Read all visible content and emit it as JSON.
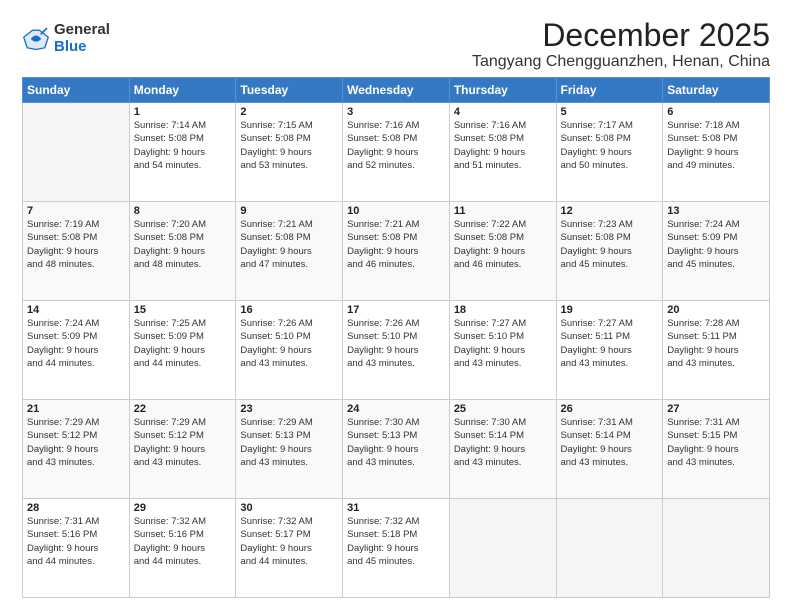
{
  "logo": {
    "general": "General",
    "blue": "Blue"
  },
  "title": {
    "month": "December 2025",
    "location": "Tangyang Chengguanzhen, Henan, China"
  },
  "days_of_week": [
    "Sunday",
    "Monday",
    "Tuesday",
    "Wednesday",
    "Thursday",
    "Friday",
    "Saturday"
  ],
  "weeks": [
    [
      {
        "day": "",
        "info": ""
      },
      {
        "day": "1",
        "info": "Sunrise: 7:14 AM\nSunset: 5:08 PM\nDaylight: 9 hours\nand 54 minutes."
      },
      {
        "day": "2",
        "info": "Sunrise: 7:15 AM\nSunset: 5:08 PM\nDaylight: 9 hours\nand 53 minutes."
      },
      {
        "day": "3",
        "info": "Sunrise: 7:16 AM\nSunset: 5:08 PM\nDaylight: 9 hours\nand 52 minutes."
      },
      {
        "day": "4",
        "info": "Sunrise: 7:16 AM\nSunset: 5:08 PM\nDaylight: 9 hours\nand 51 minutes."
      },
      {
        "day": "5",
        "info": "Sunrise: 7:17 AM\nSunset: 5:08 PM\nDaylight: 9 hours\nand 50 minutes."
      },
      {
        "day": "6",
        "info": "Sunrise: 7:18 AM\nSunset: 5:08 PM\nDaylight: 9 hours\nand 49 minutes."
      }
    ],
    [
      {
        "day": "7",
        "info": "Sunrise: 7:19 AM\nSunset: 5:08 PM\nDaylight: 9 hours\nand 48 minutes."
      },
      {
        "day": "8",
        "info": "Sunrise: 7:20 AM\nSunset: 5:08 PM\nDaylight: 9 hours\nand 48 minutes."
      },
      {
        "day": "9",
        "info": "Sunrise: 7:21 AM\nSunset: 5:08 PM\nDaylight: 9 hours\nand 47 minutes."
      },
      {
        "day": "10",
        "info": "Sunrise: 7:21 AM\nSunset: 5:08 PM\nDaylight: 9 hours\nand 46 minutes."
      },
      {
        "day": "11",
        "info": "Sunrise: 7:22 AM\nSunset: 5:08 PM\nDaylight: 9 hours\nand 46 minutes."
      },
      {
        "day": "12",
        "info": "Sunrise: 7:23 AM\nSunset: 5:08 PM\nDaylight: 9 hours\nand 45 minutes."
      },
      {
        "day": "13",
        "info": "Sunrise: 7:24 AM\nSunset: 5:09 PM\nDaylight: 9 hours\nand 45 minutes."
      }
    ],
    [
      {
        "day": "14",
        "info": "Sunrise: 7:24 AM\nSunset: 5:09 PM\nDaylight: 9 hours\nand 44 minutes."
      },
      {
        "day": "15",
        "info": "Sunrise: 7:25 AM\nSunset: 5:09 PM\nDaylight: 9 hours\nand 44 minutes."
      },
      {
        "day": "16",
        "info": "Sunrise: 7:26 AM\nSunset: 5:10 PM\nDaylight: 9 hours\nand 43 minutes."
      },
      {
        "day": "17",
        "info": "Sunrise: 7:26 AM\nSunset: 5:10 PM\nDaylight: 9 hours\nand 43 minutes."
      },
      {
        "day": "18",
        "info": "Sunrise: 7:27 AM\nSunset: 5:10 PM\nDaylight: 9 hours\nand 43 minutes."
      },
      {
        "day": "19",
        "info": "Sunrise: 7:27 AM\nSunset: 5:11 PM\nDaylight: 9 hours\nand 43 minutes."
      },
      {
        "day": "20",
        "info": "Sunrise: 7:28 AM\nSunset: 5:11 PM\nDaylight: 9 hours\nand 43 minutes."
      }
    ],
    [
      {
        "day": "21",
        "info": "Sunrise: 7:29 AM\nSunset: 5:12 PM\nDaylight: 9 hours\nand 43 minutes."
      },
      {
        "day": "22",
        "info": "Sunrise: 7:29 AM\nSunset: 5:12 PM\nDaylight: 9 hours\nand 43 minutes."
      },
      {
        "day": "23",
        "info": "Sunrise: 7:29 AM\nSunset: 5:13 PM\nDaylight: 9 hours\nand 43 minutes."
      },
      {
        "day": "24",
        "info": "Sunrise: 7:30 AM\nSunset: 5:13 PM\nDaylight: 9 hours\nand 43 minutes."
      },
      {
        "day": "25",
        "info": "Sunrise: 7:30 AM\nSunset: 5:14 PM\nDaylight: 9 hours\nand 43 minutes."
      },
      {
        "day": "26",
        "info": "Sunrise: 7:31 AM\nSunset: 5:14 PM\nDaylight: 9 hours\nand 43 minutes."
      },
      {
        "day": "27",
        "info": "Sunrise: 7:31 AM\nSunset: 5:15 PM\nDaylight: 9 hours\nand 43 minutes."
      }
    ],
    [
      {
        "day": "28",
        "info": "Sunrise: 7:31 AM\nSunset: 5:16 PM\nDaylight: 9 hours\nand 44 minutes."
      },
      {
        "day": "29",
        "info": "Sunrise: 7:32 AM\nSunset: 5:16 PM\nDaylight: 9 hours\nand 44 minutes."
      },
      {
        "day": "30",
        "info": "Sunrise: 7:32 AM\nSunset: 5:17 PM\nDaylight: 9 hours\nand 44 minutes."
      },
      {
        "day": "31",
        "info": "Sunrise: 7:32 AM\nSunset: 5:18 PM\nDaylight: 9 hours\nand 45 minutes."
      },
      {
        "day": "",
        "info": ""
      },
      {
        "day": "",
        "info": ""
      },
      {
        "day": "",
        "info": ""
      }
    ]
  ]
}
